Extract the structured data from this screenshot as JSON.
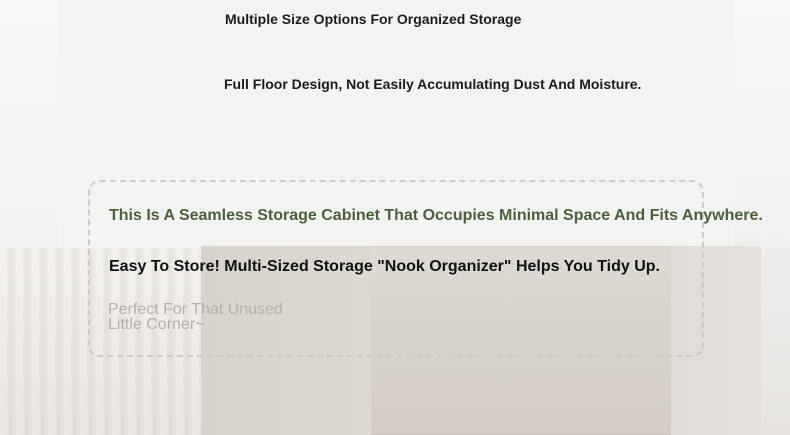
{
  "headline": {
    "line1": "Multiple Size Options For Organized Storage",
    "line2": "Full Floor Design, Not Easily Accumulating Dust And Moisture."
  },
  "promo_box": {
    "title": "This Is A Seamless Storage Cabinet That Occupies Minimal Space And Fits Anywhere.",
    "subtitle": "Easy To Store! Multi-Sized Storage \"Nook Organizer\" Helps You Tidy Up.",
    "note_line1": "Perfect For That Unused",
    "note_line2": "Little Corner~"
  }
}
